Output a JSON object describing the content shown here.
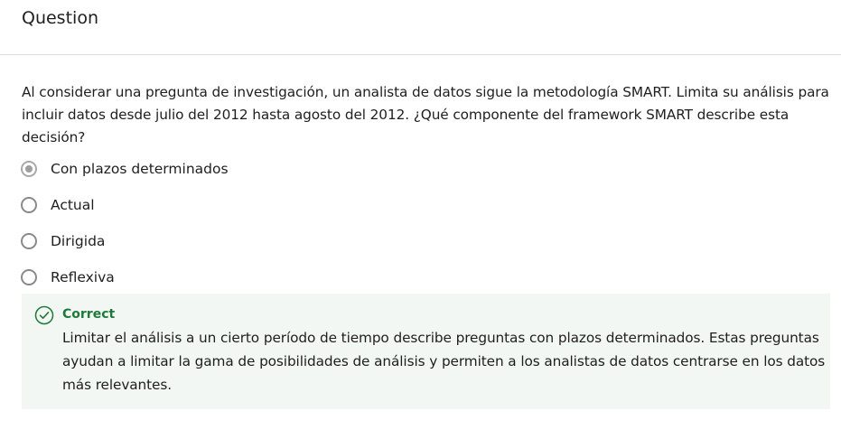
{
  "header": {
    "title": "Question"
  },
  "question": {
    "text": "Al considerar una pregunta de investigación, un analista de datos sigue la metodología SMART. Limita su análisis para incluir datos desde julio del 2012 hasta agosto del 2012. ¿Qué componente del framework SMART describe esta decisión?"
  },
  "options": [
    {
      "label": "Con plazos determinados",
      "selected": true
    },
    {
      "label": "Actual",
      "selected": false
    },
    {
      "label": "Dirigida",
      "selected": false
    },
    {
      "label": "Reflexiva",
      "selected": false
    }
  ],
  "feedback": {
    "status": "Correct",
    "icon": "check-circle-icon",
    "text": "Limitar el análisis a un cierto período de tiempo describe preguntas con plazos determinados. Estas preguntas ayudan a limitar la gama de posibilidades de análisis y permiten a los analistas de datos centrarse en los datos más relevantes.",
    "color": "#1f7a3a",
    "background": "#f2f7f3"
  }
}
